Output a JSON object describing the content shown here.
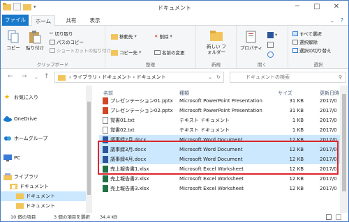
{
  "window": {
    "title": "ドキュメント"
  },
  "tabs": [
    "ファイル",
    "ホーム",
    "共有",
    "表示"
  ],
  "ribbon": {
    "clipboard": {
      "copy": "コピー",
      "paste": "貼り付け",
      "cut": "切り取り",
      "copy_path": "パスのコピー",
      "paste_shortcut": "ショートカットの貼り付け",
      "label": "クリップボード"
    },
    "organize": {
      "move_to": "移動先",
      "copy_to": "コピー先",
      "delete": "削除",
      "rename": "名前の変更",
      "label": "整理"
    },
    "new": {
      "new_folder": "新しい フォルダー",
      "label": "新規"
    },
    "open": {
      "properties": "プロパティ",
      "label": "開く"
    },
    "select": {
      "select_all": "すべて選択",
      "select_none": "選択解除",
      "invert": "選択の切り替え",
      "label": "選択"
    }
  },
  "address": {
    "path": "› ライブラリ › ドキュメント › ドキュメント",
    "search_placeholder": "ドキュメントの検索"
  },
  "nav": {
    "favorites": "お気に入り",
    "onedrive": "OneDrive",
    "homegroup": "ホームグループ",
    "pc": "PC",
    "libraries": "ライブラリ",
    "documents": "ドキュメント",
    "documents_sub1": "ドキュメント",
    "documents_sub2": "ドキュメント"
  },
  "columns": {
    "name": "名前",
    "type": "種類",
    "size": "サイズ",
    "modified": "更新日時"
  },
  "files": [
    {
      "name": "プレゼンテーション01.pptx",
      "type": "Microsoft PowerPoint Presentation",
      "size": "31 KB",
      "date": "2017/0",
      "kind": "ppt",
      "selected": false
    },
    {
      "name": "プレゼンテーション02.pptx",
      "type": "Microsoft PowerPoint Presentation",
      "size": "31 KB",
      "date": "2017/0",
      "kind": "ppt",
      "selected": false
    },
    {
      "name": "覚書01.txt",
      "type": "テキスト ドキュメント",
      "size": "1 KB",
      "date": "2017/0",
      "kind": "txt",
      "selected": false
    },
    {
      "name": "覚書02.txt",
      "type": "テキスト ドキュメント",
      "size": "1 KB",
      "date": "2017/0",
      "kind": "txt",
      "selected": false
    },
    {
      "name": "議事録2月.docx",
      "type": "Microsoft Word Document",
      "size": "12 KB",
      "date": "2017/0",
      "kind": "doc",
      "selected": true
    },
    {
      "name": "議事録3月.docx",
      "type": "Microsoft Word Document",
      "size": "12 KB",
      "date": "2017/0",
      "kind": "doc",
      "selected": true
    },
    {
      "name": "議事録4月.docx",
      "type": "Microsoft Word Document",
      "size": "12 KB",
      "date": "2017/0",
      "kind": "doc",
      "selected": true
    },
    {
      "name": "売上報告書1.xlsx",
      "type": "Microsoft Excel Worksheet",
      "size": "12 KB",
      "date": "2017/0",
      "kind": "xls",
      "selected": false
    },
    {
      "name": "売上報告書2.xlsx",
      "type": "Microsoft Excel Worksheet",
      "size": "12 KB",
      "date": "2017/0",
      "kind": "xls",
      "selected": false
    },
    {
      "name": "売上報告書3.xlsx",
      "type": "Microsoft Excel Worksheet",
      "size": "12 KB",
      "date": "2017/0",
      "kind": "xls",
      "selected": false
    }
  ],
  "status": {
    "count": "10 個の項目",
    "selection": "3 個の項目を選択",
    "size": "34.4 KB"
  },
  "colors": {
    "accent": "#1979ca",
    "selection": "#cce8ff",
    "highlight": "#e0242b",
    "ppt": "#d24726",
    "doc": "#2b579a",
    "xls": "#217346"
  }
}
